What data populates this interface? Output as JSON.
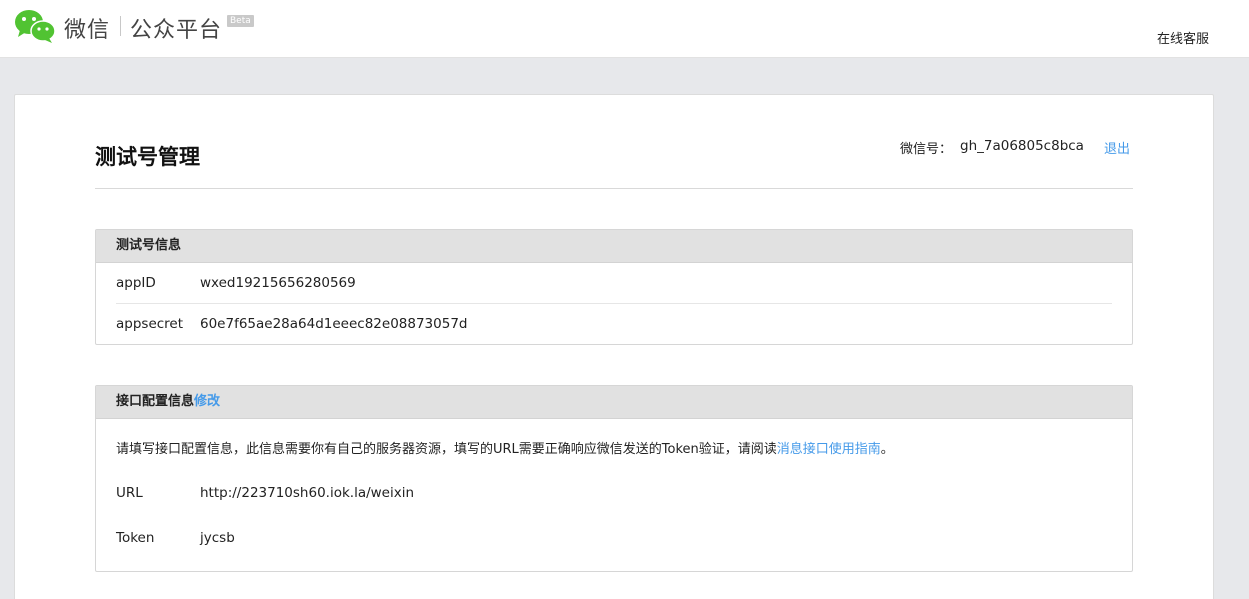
{
  "header": {
    "brand": "微信",
    "platform": "公众平台",
    "beta": "Beta",
    "service": "在线客服"
  },
  "page": {
    "title": "测试号管理",
    "account_label": "微信号：",
    "account_id": "gh_7a06805c8bca",
    "logout": "退出"
  },
  "test_account": {
    "heading": "测试号信息",
    "rows": [
      {
        "key": "appID",
        "value": "wxed19215656280569"
      },
      {
        "key": "appsecret",
        "value": "60e7f65ae28a64d1eeec82e08873057d"
      }
    ]
  },
  "interface_config": {
    "heading": "接口配置信息",
    "edit_link": "修改",
    "notice_prefix": "请填写接口配置信息，此信息需要你有自己的服务器资源，填写的URL需要正确响应微信发送的Token验证，请阅读",
    "notice_link": "消息接口使用指南",
    "notice_suffix": "。",
    "url_label": "URL",
    "url_value": "http://223710sh60.iok.la/weixin",
    "token_label": "Token",
    "token_value": "jycsb"
  },
  "colors": {
    "wechat_green": "#51c332",
    "link_blue": "#459ae9"
  }
}
